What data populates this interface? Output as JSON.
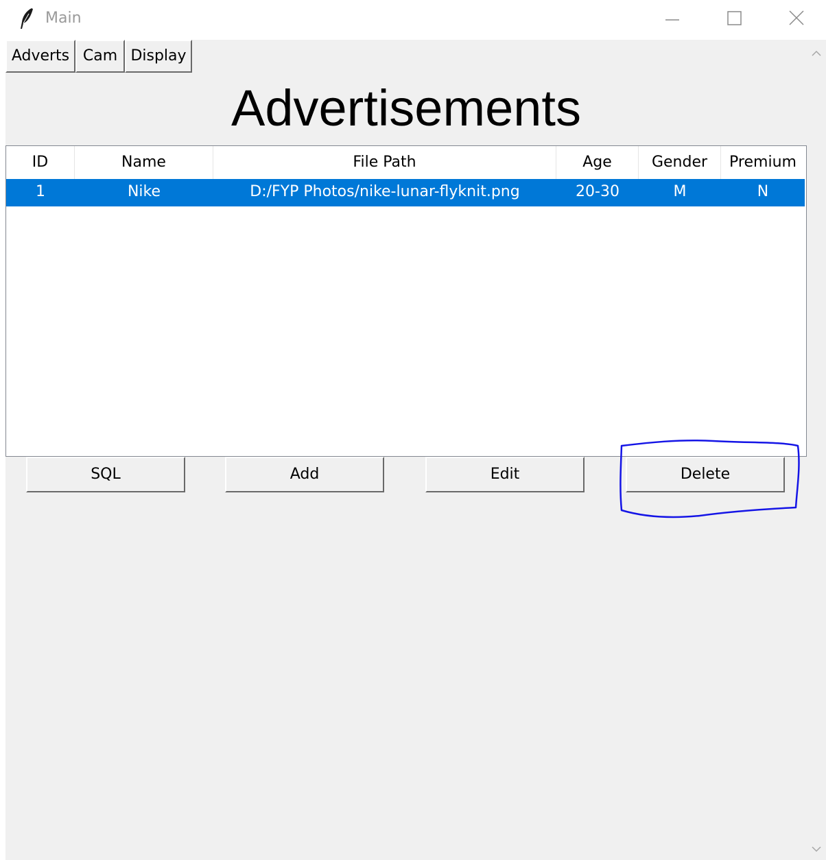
{
  "window": {
    "title": "Main",
    "app_icon": "feather-icon",
    "controls": [
      "minimize-icon",
      "maximize-icon",
      "close-icon"
    ]
  },
  "tabs": [
    {
      "label": "Adverts"
    },
    {
      "label": "Cam"
    },
    {
      "label": "Display"
    }
  ],
  "page": {
    "heading": "Advertisements"
  },
  "table": {
    "columns": [
      "ID",
      "Name",
      "File Path",
      "Age",
      "Gender",
      "Premium"
    ],
    "rows": [
      {
        "id": "1",
        "name": "Nike",
        "file_path": "D:/FYP Photos/nike-lunar-flyknit.png",
        "age": "20-30",
        "gender": "M",
        "premium": "N",
        "selected": true
      }
    ],
    "selection_color": "#0078d7"
  },
  "actions": {
    "sql_label": "SQL",
    "add_label": "Add",
    "edit_label": "Edit",
    "delete_label": "Delete"
  },
  "annotation": {
    "shape": "hand-drawn-outline",
    "target": "delete-button",
    "color": "#1414e6"
  },
  "scrollbar": {
    "up_icon": "chevron-up-icon",
    "down_icon": "chevron-down-icon"
  }
}
